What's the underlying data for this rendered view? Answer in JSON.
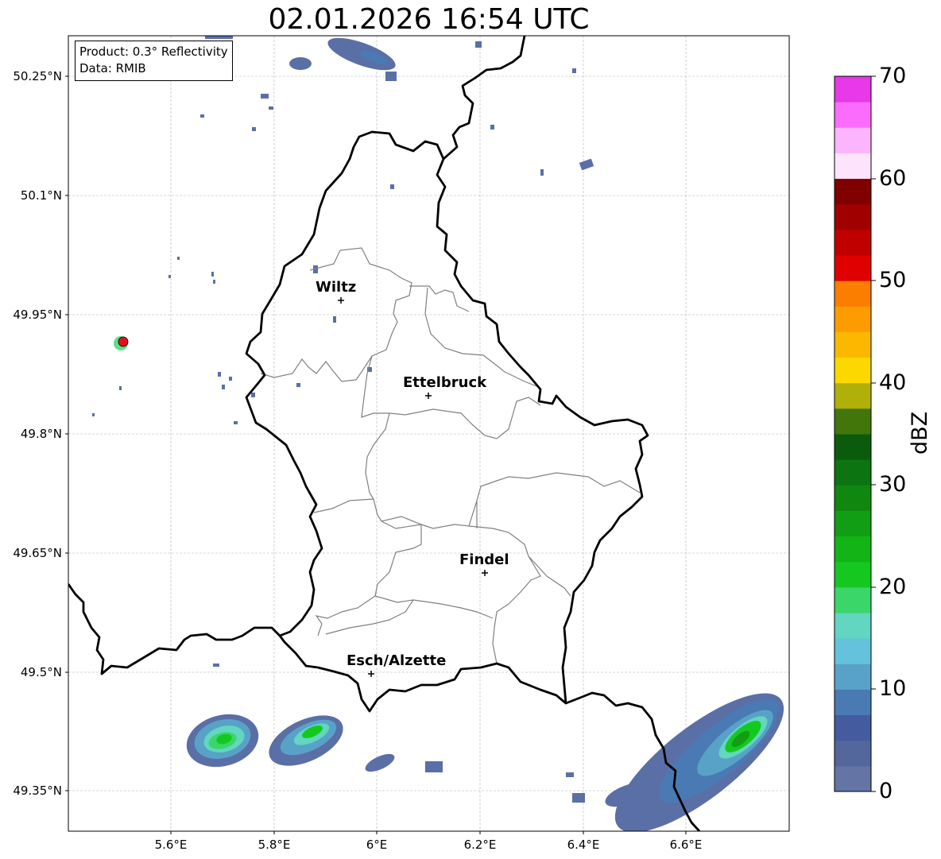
{
  "title": "02.01.2026 16:54 UTC",
  "info": {
    "product": "Product: 0.3° Reflectivity",
    "data": "Data: RMIB"
  },
  "axes": {
    "x_ticks": [
      "5.6°E",
      "5.8°E",
      "6°E",
      "6.2°E",
      "6.4°E",
      "6.6°E"
    ],
    "y_ticks": [
      "50.25°N",
      "50.1°N",
      "49.95°N",
      "49.8°N",
      "49.65°N",
      "49.5°N",
      "49.35°N"
    ],
    "lon_range": [
      5.4,
      6.8
    ],
    "lat_range": [
      49.3,
      50.3
    ],
    "grid": true
  },
  "cities": [
    {
      "name": "Wiltz",
      "lon": 5.93,
      "lat": 49.97
    },
    {
      "name": "Ettelbruck",
      "lon": 6.1,
      "lat": 49.85
    },
    {
      "name": "Findel",
      "lon": 6.21,
      "lat": 49.63
    },
    {
      "name": "Esch/Alzette",
      "lon": 5.99,
      "lat": 49.5
    }
  ],
  "radar_site": {
    "lon": 5.505,
    "lat": 49.914,
    "color": "#e0101a"
  },
  "colorbar": {
    "label": "dBZ",
    "ticks": [
      "0",
      "10",
      "20",
      "30",
      "40",
      "50",
      "60",
      "70"
    ],
    "colors": [
      "#6474a4",
      "#54679c",
      "#445ba0",
      "#4a7ab4",
      "#58a2c8",
      "#64c2dc",
      "#62d6c0",
      "#3ad66a",
      "#14c820",
      "#12b416",
      "#129e14",
      "#10880f",
      "#0c7410",
      "#0a5c0c",
      "#42760a",
      "#b0b00a",
      "#fcd800",
      "#fcb800",
      "#fc9c00",
      "#fc7e00",
      "#e00000",
      "#c00000",
      "#a00000",
      "#800000",
      "#fde4fc",
      "#fcb4fc",
      "#fc6cfc",
      "#e838e8"
    ]
  },
  "map_colors": {
    "border": "#000000",
    "cantons": "#808080"
  }
}
